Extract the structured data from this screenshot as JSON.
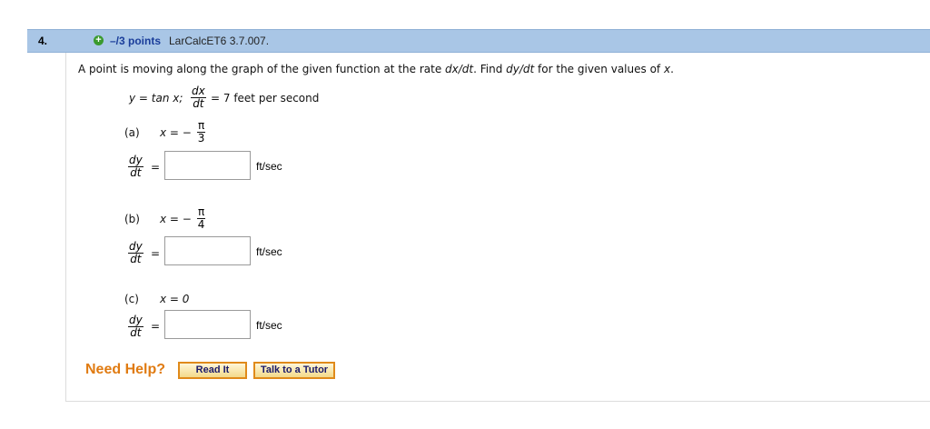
{
  "header": {
    "question_number": "4.",
    "plus_glyph": "+",
    "points": "–/3 points",
    "course_code": "LarCalcET6 3.7.007."
  },
  "prompt": {
    "text_1": "A point is moving along the graph of the given function at the rate ",
    "rate_var": "dx/dt",
    "text_2": ". Find ",
    "find_var": "dy/dt",
    "text_3": " for the given values of ",
    "x_var": "x",
    "text_4": "."
  },
  "given": {
    "lhs": "y = tan x;",
    "dx": "dx",
    "dt": "dt",
    "rhs": "= 7 feet per second"
  },
  "parts": [
    {
      "label": "(a)",
      "x_expr": "x = −",
      "pi": "π",
      "den": "3",
      "dy": "dy",
      "dt": "dt",
      "eq": "=",
      "unit": "ft/sec"
    },
    {
      "label": "(b)",
      "x_expr": "x = −",
      "pi": "π",
      "den": "4",
      "dy": "dy",
      "dt": "dt",
      "eq": "=",
      "unit": "ft/sec"
    },
    {
      "label": "(c)",
      "x_expr": "x = 0",
      "dy": "dy",
      "dt": "dt",
      "eq": "=",
      "unit": "ft/sec"
    }
  ],
  "help": {
    "label": "Need Help?",
    "read_it": "Read It",
    "tutor": "Talk to a Tutor"
  },
  "colors": {
    "header_bg": "#a9c6e6",
    "points_text": "#1a3d9a",
    "help_text": "#e07b12",
    "button_border": "#e08a1a"
  }
}
